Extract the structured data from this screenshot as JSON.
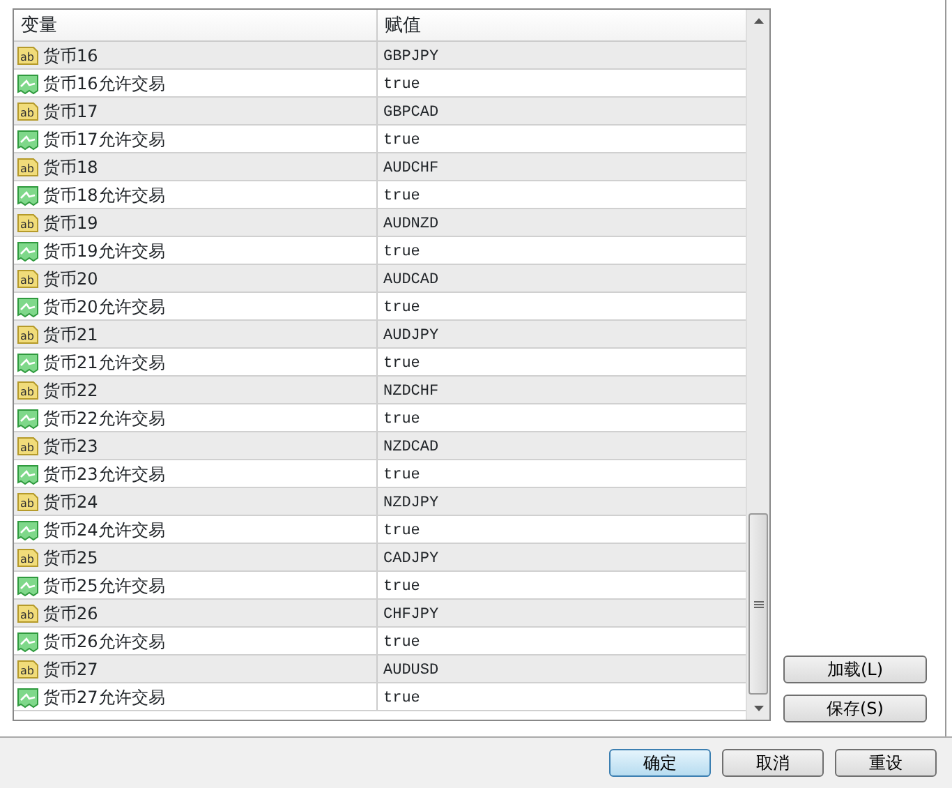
{
  "table": {
    "columns": [
      "变量",
      "赋值"
    ],
    "rows": [
      {
        "kind": "string",
        "icon_label": "ab",
        "name": "货币16",
        "value": "GBPJPY"
      },
      {
        "kind": "bool",
        "name": "货币16允许交易",
        "value": "true"
      },
      {
        "kind": "string",
        "icon_label": "ab",
        "name": "货币17",
        "value": "GBPCAD"
      },
      {
        "kind": "bool",
        "name": "货币17允许交易",
        "value": "true"
      },
      {
        "kind": "string",
        "icon_label": "ab",
        "name": "货币18",
        "value": "AUDCHF"
      },
      {
        "kind": "bool",
        "name": "货币18允许交易",
        "value": "true"
      },
      {
        "kind": "string",
        "icon_label": "ab",
        "name": "货币19",
        "value": "AUDNZD"
      },
      {
        "kind": "bool",
        "name": "货币19允许交易",
        "value": "true"
      },
      {
        "kind": "string",
        "icon_label": "ab",
        "name": "货币20",
        "value": "AUDCAD"
      },
      {
        "kind": "bool",
        "name": "货币20允许交易",
        "value": "true"
      },
      {
        "kind": "string",
        "icon_label": "ab",
        "name": "货币21",
        "value": "AUDJPY"
      },
      {
        "kind": "bool",
        "name": "货币21允许交易",
        "value": "true"
      },
      {
        "kind": "string",
        "icon_label": "ab",
        "name": "货币22",
        "value": "NZDCHF"
      },
      {
        "kind": "bool",
        "name": "货币22允许交易",
        "value": "true"
      },
      {
        "kind": "string",
        "icon_label": "ab",
        "name": "货币23",
        "value": "NZDCAD"
      },
      {
        "kind": "bool",
        "name": "货币23允许交易",
        "value": "true"
      },
      {
        "kind": "string",
        "icon_label": "ab",
        "name": "货币24",
        "value": "NZDJPY"
      },
      {
        "kind": "bool",
        "name": "货币24允许交易",
        "value": "true"
      },
      {
        "kind": "string",
        "icon_label": "ab",
        "name": "货币25",
        "value": "CADJPY"
      },
      {
        "kind": "bool",
        "name": "货币25允许交易",
        "value": "true"
      },
      {
        "kind": "string",
        "icon_label": "ab",
        "name": "货币26",
        "value": "CHFJPY"
      },
      {
        "kind": "bool",
        "name": "货币26允许交易",
        "value": "true"
      },
      {
        "kind": "string",
        "icon_label": "ab",
        "name": "货币27",
        "value": "AUDUSD"
      },
      {
        "kind": "bool",
        "name": "货币27允许交易",
        "value": "true"
      }
    ]
  },
  "side_buttons": [
    "加载(L)",
    "保存(S)"
  ],
  "footer_buttons": [
    {
      "label": "确定",
      "default": true
    },
    {
      "label": "取消",
      "default": false
    },
    {
      "label": "重设",
      "default": false
    }
  ]
}
